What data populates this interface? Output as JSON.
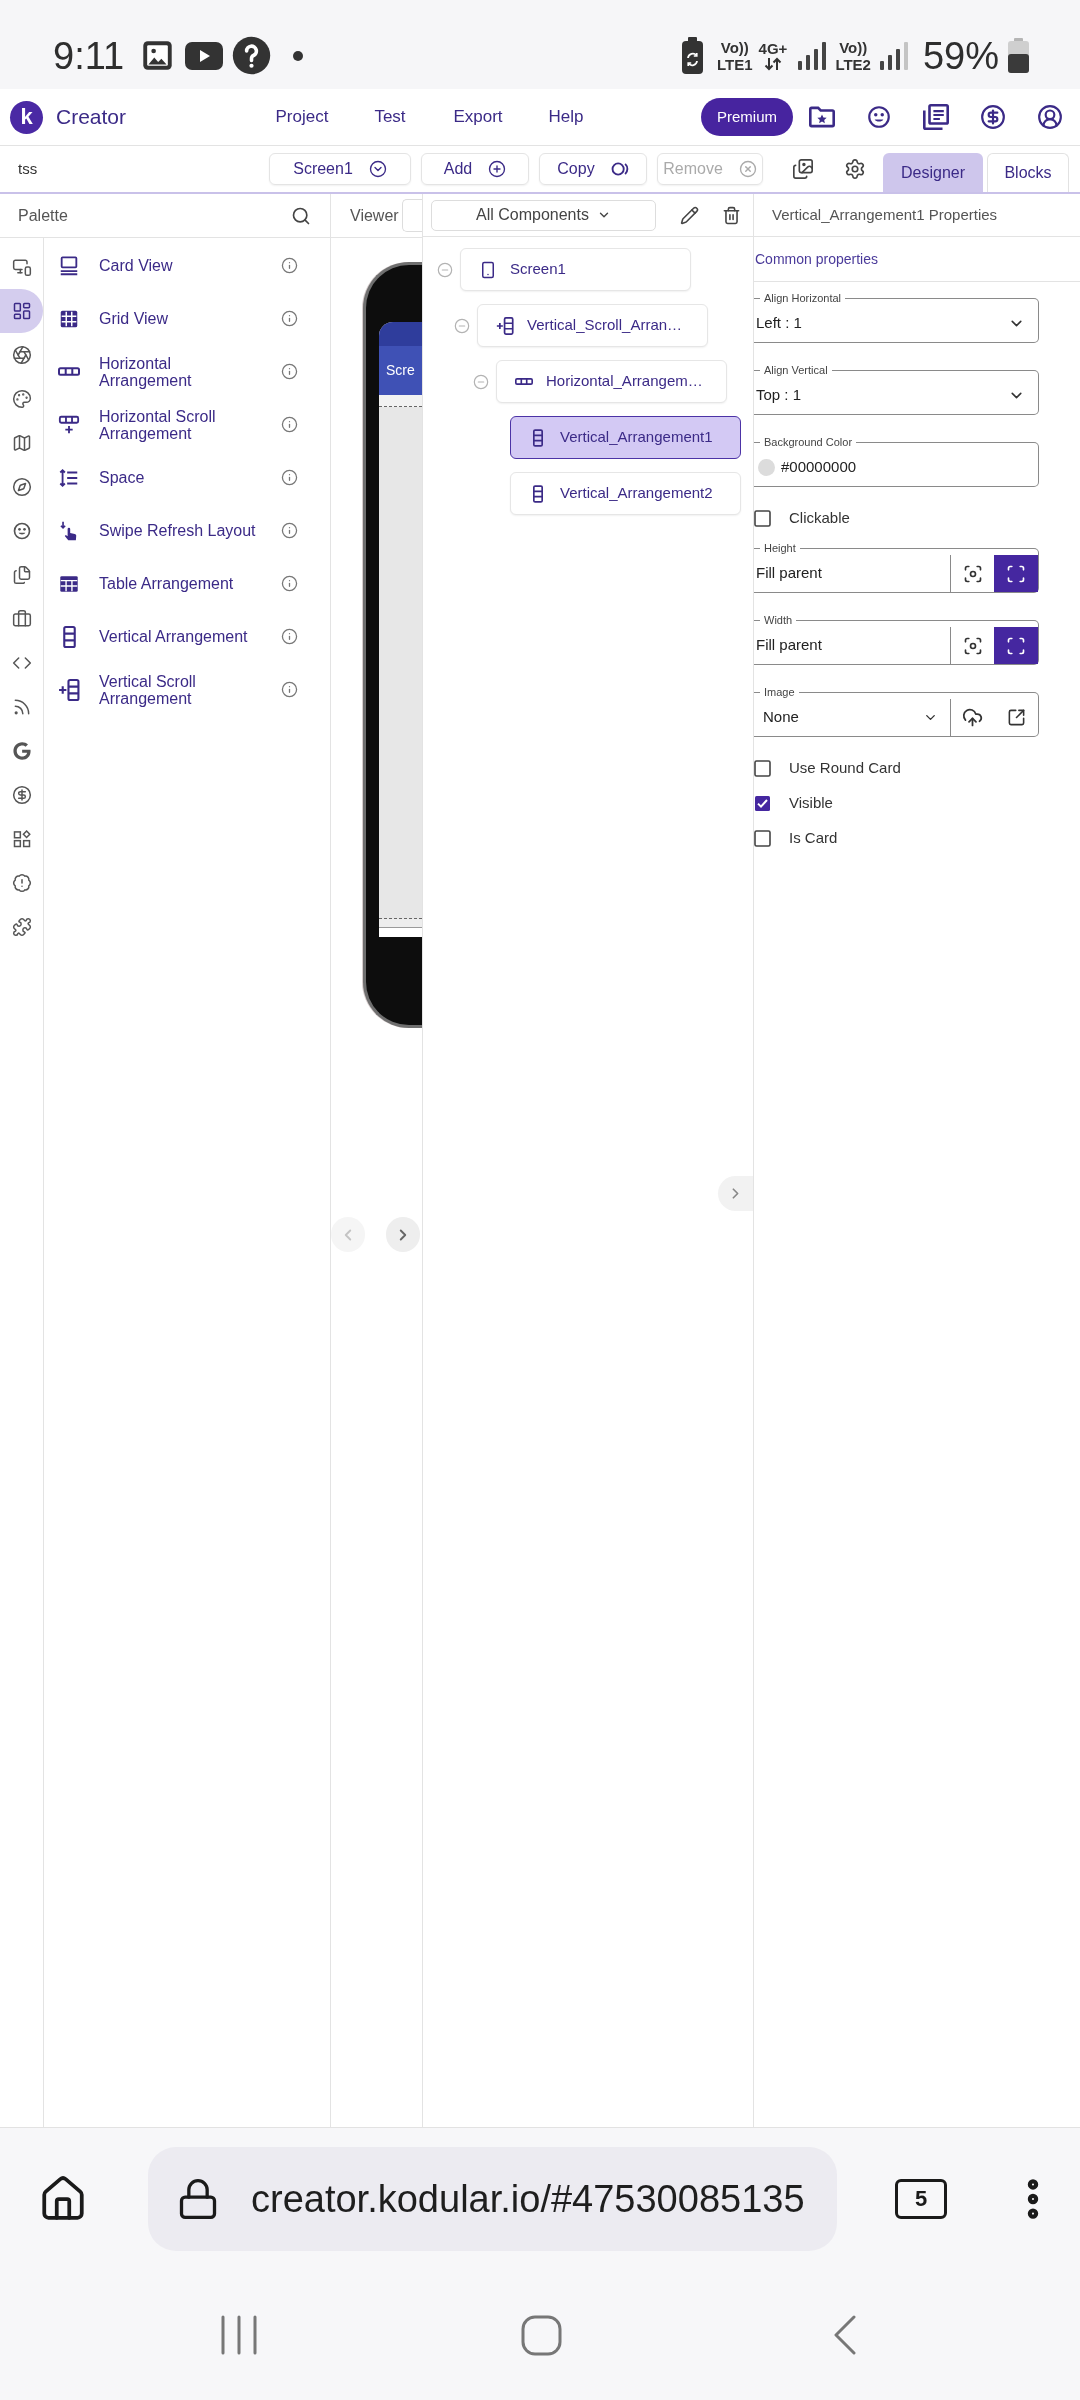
{
  "status_bar": {
    "time": "9:11",
    "sim_1": {
      "voice": "Vo))",
      "network": "LTE1"
    },
    "data": "4G+",
    "sim_2": {
      "voice": "Vo))",
      "network": "LTE2"
    },
    "battery": "59%"
  },
  "app_bar": {
    "logo_letter": "k",
    "title": "Creator",
    "menu": [
      "Project",
      "Test",
      "Export",
      "Help"
    ],
    "premium": "Premium"
  },
  "toolbar": {
    "project": "tss",
    "buttons": [
      {
        "label": "Screen1",
        "disabled": false
      },
      {
        "label": "Add",
        "disabled": false
      },
      {
        "label": "Copy",
        "disabled": false
      },
      {
        "label": "Remove",
        "disabled": true
      }
    ],
    "tabs": [
      {
        "label": "Designer",
        "selected": true
      },
      {
        "label": "Blocks",
        "selected": false
      }
    ]
  },
  "palette": {
    "title": "Palette",
    "categories": [
      {
        "selected": false
      },
      {
        "selected": true
      },
      {
        "selected": false
      },
      {
        "selected": false
      },
      {
        "selected": false
      },
      {
        "selected": false
      },
      {
        "selected": false
      },
      {
        "selected": false
      },
      {
        "selected": false
      },
      {
        "selected": false
      },
      {
        "selected": false
      },
      {
        "selected": false
      },
      {
        "selected": false
      },
      {
        "selected": false
      },
      {
        "selected": false
      },
      {
        "selected": false
      }
    ],
    "items": [
      "Card View",
      "Grid View",
      "Horizontal Arrangement",
      "Horizontal Scroll Arrangement",
      "Space",
      "Swipe Refresh Layout",
      "Table Arrangement",
      "Vertical Arrangement",
      "Vertical Scroll Arrangement"
    ]
  },
  "viewer": {
    "title": "Viewer",
    "phone_title": "Scre",
    "nav_buttons": [
      {
        "disabled": true
      },
      {
        "disabled": false
      }
    ]
  },
  "components": {
    "filter": "All Components",
    "tree": [
      {
        "kind": "screen",
        "name": "Screen1",
        "expanded": true,
        "selected": false,
        "children": [
          {
            "kind": "vertical_scroll",
            "name": "Vertical_Scroll_Arran…",
            "expanded": true,
            "selected": false,
            "children": [
              {
                "kind": "horizontal",
                "name": "Horizontal_Arrangem…",
                "expanded": true,
                "selected": false,
                "children": [
                  {
                    "kind": "vertical",
                    "name": "Vertical_Arrangement1",
                    "selected": true
                  },
                  {
                    "kind": "vertical",
                    "name": "Vertical_Arrangement2",
                    "selected": false
                  }
                ]
              }
            ]
          }
        ]
      }
    ]
  },
  "properties": {
    "title": "Vertical_Arrangement1 Properties",
    "section": "Common properties",
    "fields": [
      {
        "kind": "select",
        "label": "Align Horizontal",
        "value": "Left : 1"
      },
      {
        "kind": "select",
        "label": "Align Vertical",
        "value": "Top : 1"
      },
      {
        "kind": "color",
        "label": "Background Color",
        "value": "#00000000"
      },
      {
        "kind": "checkbox",
        "label": "Clickable",
        "checked": false
      },
      {
        "kind": "size",
        "label": "Height",
        "value": "Fill parent",
        "modes": [
          {
            "selected": false
          },
          {
            "selected": true
          }
        ]
      },
      {
        "kind": "size",
        "label": "Width",
        "value": "Fill parent",
        "modes": [
          {
            "selected": false
          },
          {
            "selected": true
          }
        ]
      },
      {
        "kind": "image",
        "label": "Image",
        "value": "None"
      },
      {
        "kind": "checkbox",
        "label": "Use Round Card",
        "checked": false
      },
      {
        "kind": "checkbox",
        "label": "Visible",
        "checked": true
      },
      {
        "kind": "checkbox",
        "label": "Is Card",
        "checked": false
      }
    ]
  },
  "browser": {
    "url": "creator.kodular.io/#47530085135",
    "tab_count": "5"
  }
}
